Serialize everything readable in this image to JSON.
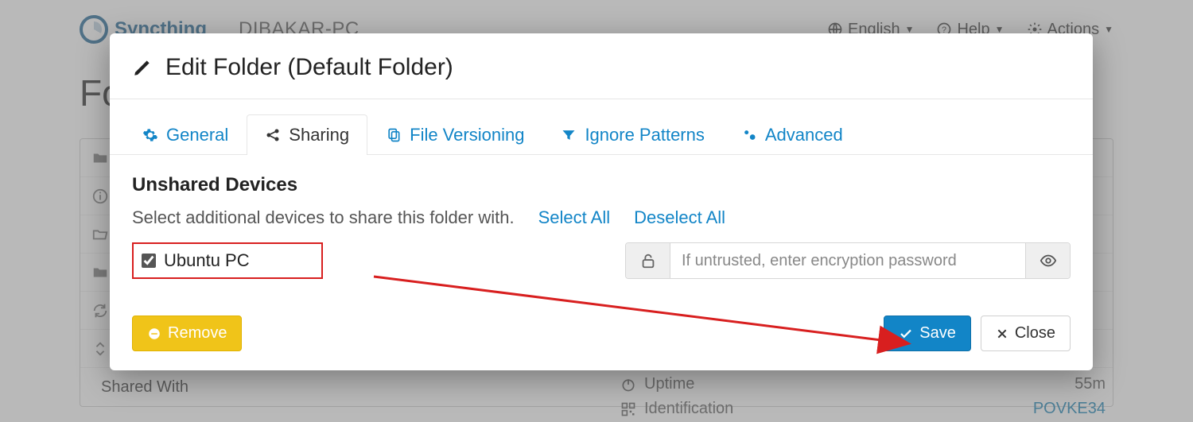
{
  "brand": {
    "name": "Syncthing"
  },
  "header": {
    "device": "DIBAKAR-PC",
    "nav": {
      "language": "English",
      "help": "Help",
      "actions": "Actions"
    }
  },
  "background": {
    "heading_prefix": "Fo",
    "shared_with": "Shared With",
    "uptime_label": "Uptime",
    "uptime_value": "55m",
    "identification_label": "Identification",
    "identification_value": "POVKE34"
  },
  "modal": {
    "title": "Edit Folder (Default Folder)",
    "tabs": {
      "general": "General",
      "sharing": "Sharing",
      "file_versioning": "File Versioning",
      "ignore_patterns": "Ignore Patterns",
      "advanced": "Advanced"
    },
    "section_heading": "Unshared Devices",
    "help_text": "Select additional devices to share this folder with.",
    "select_all": "Select All",
    "deselect_all": "Deselect All",
    "device": {
      "name": "Ubuntu PC",
      "checked": true
    },
    "password": {
      "placeholder": "If untrusted, enter encryption password"
    },
    "buttons": {
      "remove": "Remove",
      "save": "Save",
      "close": "Close"
    }
  }
}
